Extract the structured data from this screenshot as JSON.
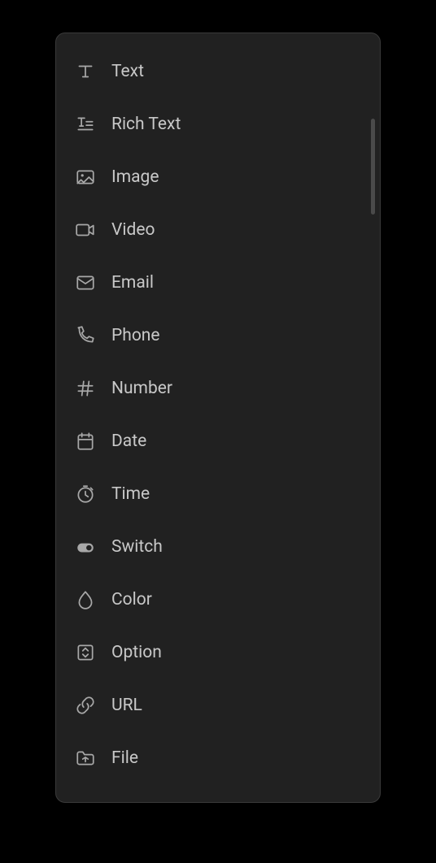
{
  "menu": {
    "items": [
      {
        "id": "text",
        "label": "Text"
      },
      {
        "id": "rich-text",
        "label": "Rich Text"
      },
      {
        "id": "image",
        "label": "Image"
      },
      {
        "id": "video",
        "label": "Video"
      },
      {
        "id": "email",
        "label": "Email"
      },
      {
        "id": "phone",
        "label": "Phone"
      },
      {
        "id": "number",
        "label": "Number"
      },
      {
        "id": "date",
        "label": "Date"
      },
      {
        "id": "time",
        "label": "Time"
      },
      {
        "id": "switch",
        "label": "Switch"
      },
      {
        "id": "color",
        "label": "Color"
      },
      {
        "id": "option",
        "label": "Option"
      },
      {
        "id": "url",
        "label": "URL"
      },
      {
        "id": "file",
        "label": "File"
      }
    ]
  }
}
